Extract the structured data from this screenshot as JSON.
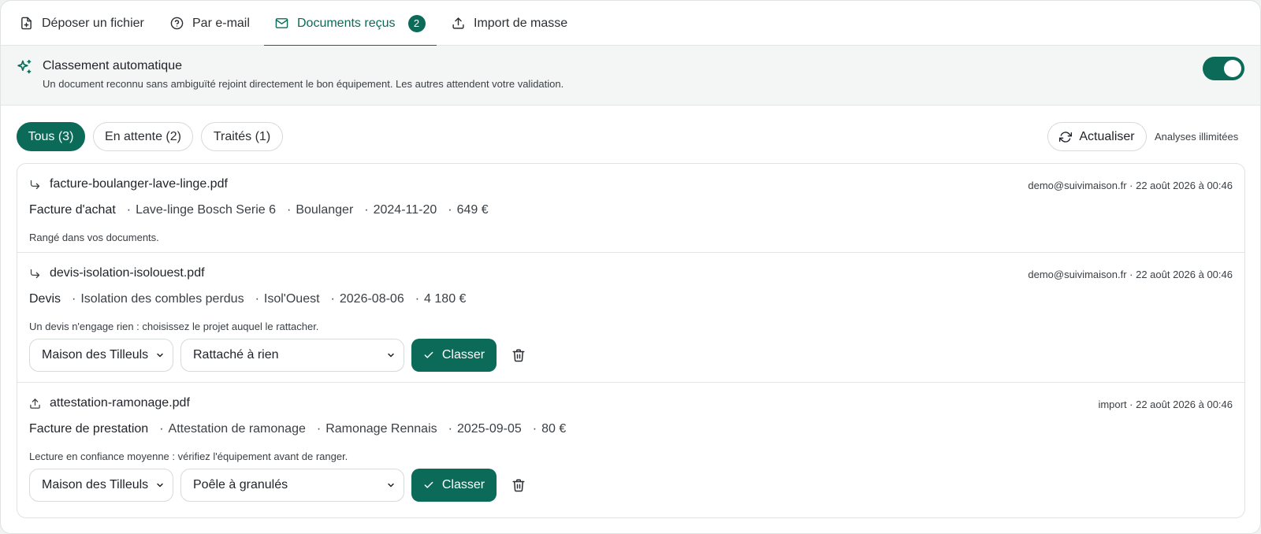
{
  "tabs": [
    {
      "label": "Déposer un fichier",
      "icon": "file-plus-icon"
    },
    {
      "label": "Par e-mail",
      "icon": "question-circle-icon"
    },
    {
      "label": "Documents reçus",
      "icon": "mail-icon",
      "count": "2",
      "active": true
    },
    {
      "label": "Import de masse",
      "icon": "upload-icon"
    }
  ],
  "auto_classification": {
    "title": "Classement automatique",
    "description": "Un document reconnu sans ambiguïté rejoint directement le bon équipement. Les autres attendent votre validation.",
    "enabled": true,
    "icon": "sparkles-icon"
  },
  "filters": [
    {
      "label": "Tous (3)",
      "active": true
    },
    {
      "label": "En attente (2)",
      "active": false
    },
    {
      "label": "Traités (1)",
      "active": false
    }
  ],
  "refresh_label": "Actualiser",
  "analyses_label": "Analyses illimitées",
  "documents": [
    {
      "filename": "facture-boulanger-lave-linge.pdf",
      "source_icon": "forward-arrow-icon",
      "meta": "demo@suivimaison.fr · 22 août 2026 à 00:46",
      "type": "Facture d'achat",
      "details": [
        "Lave-linge Bosch Serie 6",
        "Boulanger",
        "2024-11-20",
        "649 €"
      ],
      "note": "Rangé dans vos documents."
    },
    {
      "filename": "devis-isolation-isolouest.pdf",
      "source_icon": "forward-arrow-icon",
      "meta": "demo@suivimaison.fr · 22 août 2026 à 00:46",
      "type": "Devis",
      "details": [
        "Isolation des combles perdus",
        "Isol'Ouest",
        "2026-08-06",
        "4 180 €"
      ],
      "note": "Un devis n'engage rien : choisissez le projet auquel le rattacher.",
      "home_select": "Maison des Tilleuls",
      "target_select": "Rattaché à rien",
      "action_label": "Classer"
    },
    {
      "filename": "attestation-ramonage.pdf",
      "source_icon": "upload-icon",
      "meta": "import · 22 août 2026 à 00:46",
      "type": "Facture de prestation",
      "details": [
        "Attestation de ramonage",
        "Ramonage Rennais",
        "2025-09-05",
        "80 €"
      ],
      "note": "Lecture en confiance moyenne : vérifiez l'équipement avant de ranger.",
      "home_select": "Maison des Tilleuls",
      "target_select": "Poêle à granulés",
      "action_label": "Classer"
    }
  ],
  "colors": {
    "accent": "#0b6b58",
    "banner_bg": "#f3f6f4"
  }
}
